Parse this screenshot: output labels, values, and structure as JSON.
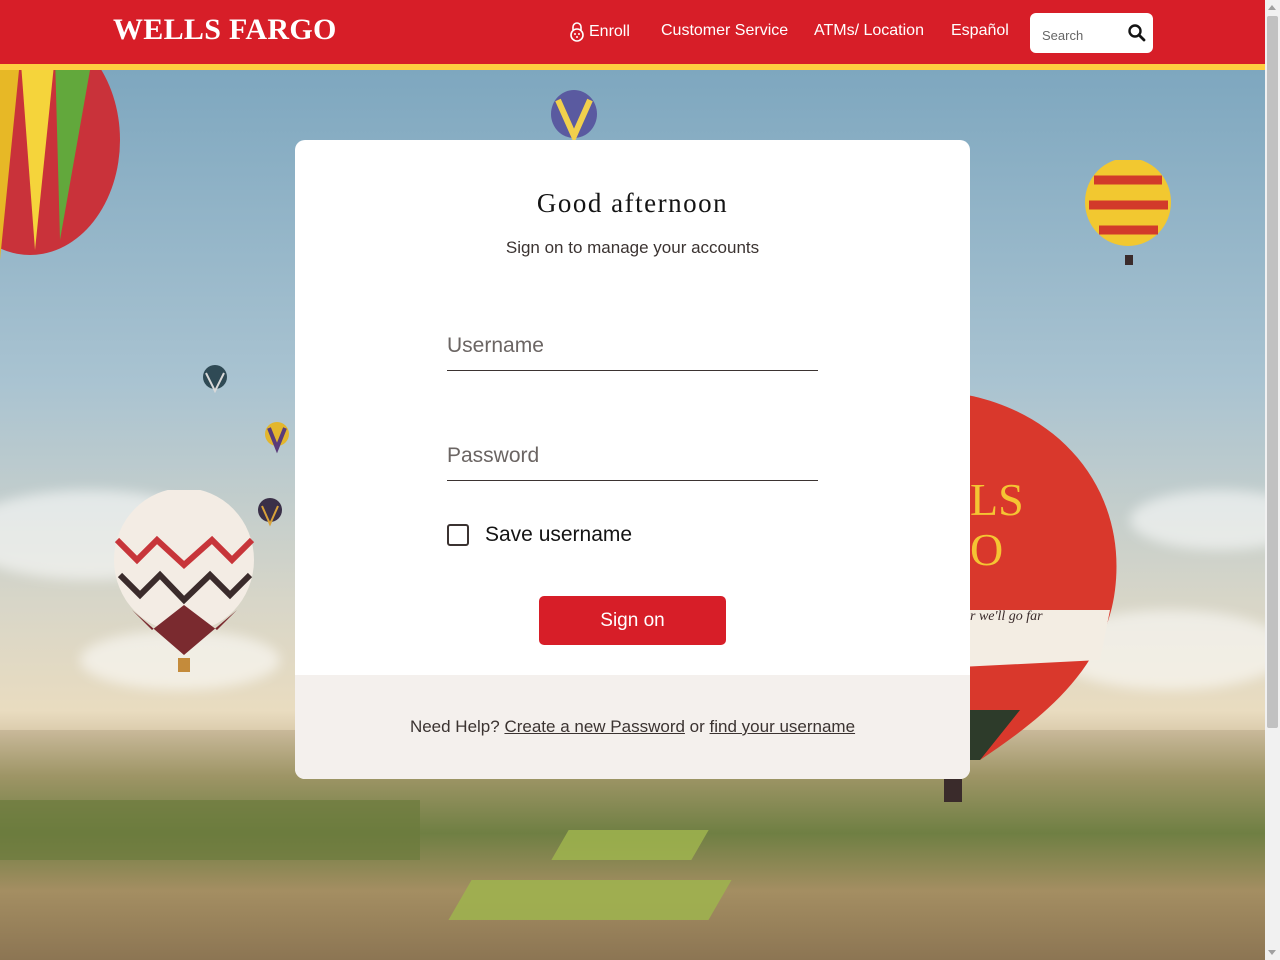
{
  "header": {
    "logo": "WELLS FARGO",
    "nav": {
      "enroll": "Enroll",
      "customer_service": "Customer Service",
      "atms": "ATMs/ Location",
      "espanol": "Español"
    },
    "search": {
      "placeholder": "Search"
    },
    "brand_color": "#d71e28",
    "accent_color": "#ffcd41"
  },
  "signon": {
    "greeting": "Good afternoon",
    "subtitle": "Sign on to manage your accounts",
    "username_placeholder": "Username",
    "password_placeholder": "Password",
    "save_username_label": "Save username",
    "save_username_checked": false,
    "button_label": "Sign on"
  },
  "help": {
    "prefix": "Need Help?",
    "create_password_link": "Create a new Password",
    "or": "or",
    "find_username_link": "find your username"
  },
  "balloon_text": {
    "line1": "LS",
    "line2": "O",
    "tagline": "r we'll go far"
  }
}
